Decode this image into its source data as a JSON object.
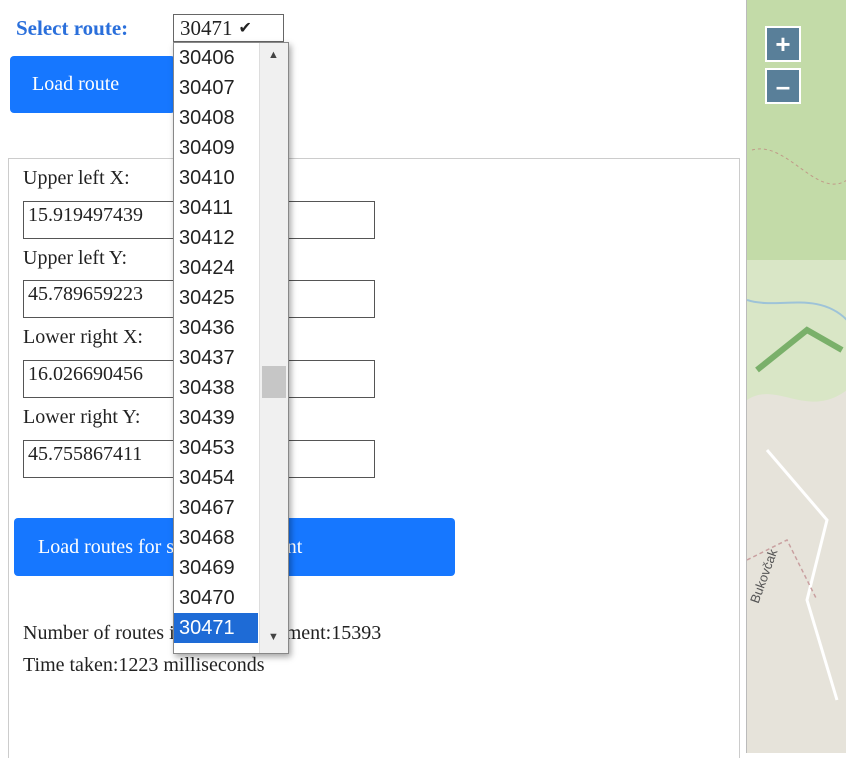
{
  "route_selector": {
    "label": "Select route:",
    "selected_value": "30471",
    "chevron": "chevron-down-icon"
  },
  "buttons": {
    "load_route": "Load route",
    "load_routes_segment": "Load routes for selected segment"
  },
  "fields": [
    {
      "label": "Upper left X:",
      "value": "15.919497439"
    },
    {
      "label": "Upper left Y:",
      "value": "45.789659223"
    },
    {
      "label": "Lower right X:",
      "value": "16.026690456"
    },
    {
      "label": "Lower right Y:",
      "value": "45.755867411"
    }
  ],
  "info": {
    "count_line": "Number of routes in selected segment:15393",
    "time_line": "Time taken:1223 milliseconds"
  },
  "dropdown": {
    "options": [
      "30406",
      "30407",
      "30408",
      "30409",
      "30410",
      "30411",
      "30412",
      "30424",
      "30425",
      "30436",
      "30437",
      "30438",
      "30439",
      "30453",
      "30454",
      "30467",
      "30468",
      "30469",
      "30470",
      "30471"
    ],
    "selected": "30471"
  },
  "map": {
    "zoom_in": "+",
    "zoom_out": "–",
    "place_label": "Bukovčak"
  }
}
